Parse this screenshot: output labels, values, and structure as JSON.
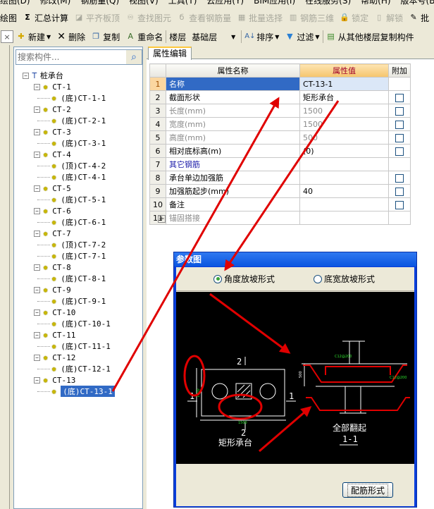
{
  "menubar": {
    "items": [
      "绘图(D)",
      "修改(M)",
      "钢筋量(Q)",
      "视图(V)",
      "工具(T)",
      "云应用(Y)",
      "BIM应用(I)",
      "在线服务(S)",
      "帮助(H)",
      "版本号(B)"
    ]
  },
  "toolbar1": {
    "items": [
      {
        "label": "绘图",
        "icon": "draw-icon",
        "enabled": true
      },
      {
        "label": "汇总计算",
        "icon": "sigma-icon",
        "enabled": true
      },
      {
        "label": "平齐板顶",
        "icon": "align-slab-icon",
        "enabled": false
      },
      {
        "label": "查找图元",
        "icon": "binoculars-icon",
        "enabled": false
      },
      {
        "label": "查看钢筋量",
        "icon": "rebar-view-icon",
        "enabled": false
      },
      {
        "label": "批量选择",
        "icon": "batch-select-icon",
        "enabled": false
      },
      {
        "label": "钢筋三维",
        "icon": "rebar-3d-icon",
        "enabled": false
      },
      {
        "label": "锁定",
        "icon": "lock-icon",
        "enabled": false
      },
      {
        "label": "解锁",
        "icon": "unlock-icon",
        "enabled": false
      },
      {
        "label": "批",
        "icon": "pen-icon",
        "enabled": true
      }
    ]
  },
  "toolbar2": {
    "close_label": "×",
    "new_label": "新建",
    "delete_label": "删除",
    "copy_label": "复制",
    "rename_label": "重命名",
    "floor_label": "楼层",
    "floor_value": "基础层",
    "sort_label": "排序",
    "filter_label": "过滤",
    "copy_from_floor_label": "从其他楼层复制构件"
  },
  "left_panel": {
    "search_placeholder": "搜索构件...",
    "tree": {
      "root": "桩承台",
      "groups": [
        {
          "name": "CT-1",
          "children": [
            "(底)CT-1-1"
          ]
        },
        {
          "name": "CT-2",
          "children": [
            "(底)CT-2-1"
          ]
        },
        {
          "name": "CT-3",
          "children": [
            "(底)CT-3-1"
          ]
        },
        {
          "name": "CT-4",
          "children": [
            "(顶)CT-4-2",
            "(底)CT-4-1"
          ]
        },
        {
          "name": "CT-5",
          "children": [
            "(底)CT-5-1"
          ]
        },
        {
          "name": "CT-6",
          "children": [
            "(底)CT-6-1"
          ]
        },
        {
          "name": "CT-7",
          "children": [
            "(顶)CT-7-2",
            "(底)CT-7-1"
          ]
        },
        {
          "name": "CT-8",
          "children": [
            "(底)CT-8-1"
          ]
        },
        {
          "name": "CT-9",
          "children": [
            "(底)CT-9-1"
          ]
        },
        {
          "name": "CT-10",
          "children": [
            "(底)CT-10-1"
          ]
        },
        {
          "name": "CT-11",
          "children": [
            "(底)CT-11-1"
          ]
        },
        {
          "name": "CT-12",
          "children": [
            "(底)CT-12-1"
          ]
        },
        {
          "name": "CT-13",
          "children": [
            "(底)CT-13-1"
          ]
        }
      ],
      "selected": "(底)CT-13-1"
    }
  },
  "property_panel": {
    "tab_label": "属性编辑",
    "headers": {
      "name": "属性名称",
      "value": "属性值",
      "extra": "附加"
    },
    "rows": [
      {
        "num": "1",
        "name": "名称",
        "value": "CT-13-1",
        "style": "selected",
        "checkbox": false
      },
      {
        "num": "2",
        "name": "截面形状",
        "value": "矩形承台",
        "style": "normal",
        "checkbox": true
      },
      {
        "num": "3",
        "name": "长度(mm)",
        "value": "1500",
        "style": "gray",
        "checkbox": true
      },
      {
        "num": "4",
        "name": "宽度(mm)",
        "value": "1500",
        "style": "gray",
        "checkbox": true
      },
      {
        "num": "5",
        "name": "高度(mm)",
        "value": "500",
        "style": "gray",
        "checkbox": true
      },
      {
        "num": "6",
        "name": "相对底标高(m)",
        "value": "(0)",
        "style": "normal",
        "checkbox": true
      },
      {
        "num": "7",
        "name": "其它钢筋",
        "value": "",
        "style": "blue",
        "checkbox": false
      },
      {
        "num": "8",
        "name": "承台单边加强筋",
        "value": "",
        "style": "normal",
        "checkbox": true
      },
      {
        "num": "9",
        "name": "加强筋起步(mm)",
        "value": "40",
        "style": "normal",
        "checkbox": true
      },
      {
        "num": "10",
        "name": "备注",
        "value": "",
        "style": "normal",
        "checkbox": true
      },
      {
        "num": "11",
        "name": "锚固搭接",
        "value": "",
        "style": "group",
        "checkbox": false
      }
    ]
  },
  "dialog": {
    "title": "参数图",
    "radio_options": [
      {
        "label": "角度放坡形式",
        "checked": true
      },
      {
        "label": "底宽放坡形式",
        "checked": false
      }
    ],
    "drawing": {
      "plan_caption": "矩形承台",
      "plan_dim_width": "1500",
      "plan_dim_height": "1500",
      "section_mark_top": "2",
      "section_mark_bottom": "2",
      "section_mark_left": "1",
      "section_mark_right": "1",
      "section_caption": "全部翻起",
      "section_label": "1-1",
      "rebar_label": "C12@200",
      "height_dim": "500"
    },
    "button_label": "配筋形式"
  },
  "annotation_color": "#e00000"
}
